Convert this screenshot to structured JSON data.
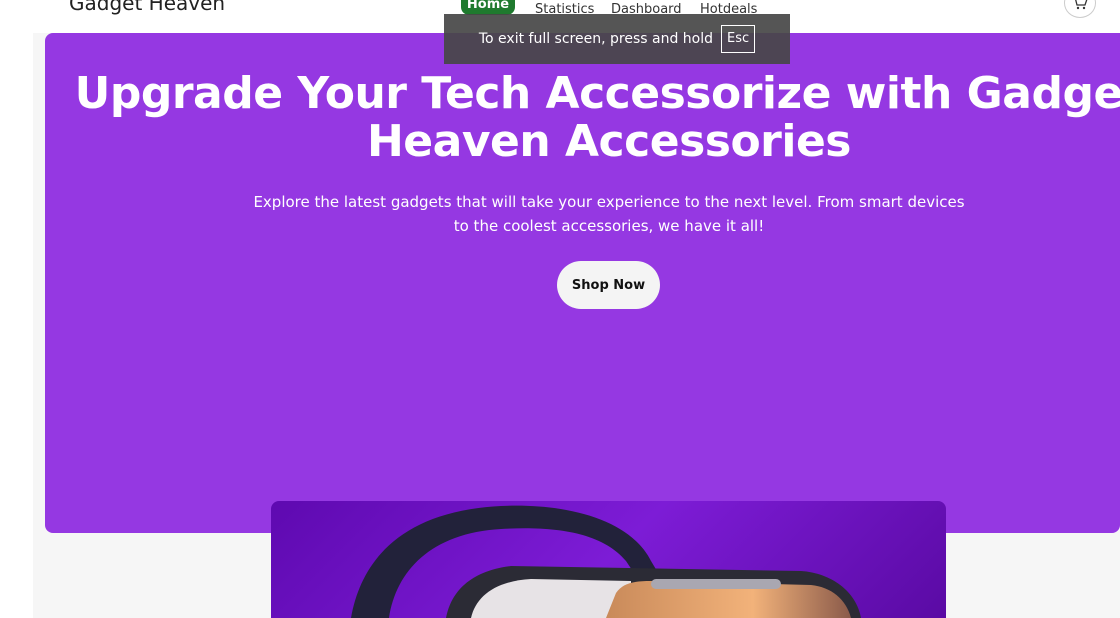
{
  "header": {
    "brand": "Gadget Heaven",
    "nav": {
      "home": "Home",
      "statistics": "Statistics",
      "dashboard": "Dashboard",
      "hotdeals": "Hotdeals"
    },
    "cart_icon": "cart-icon"
  },
  "hero": {
    "title": "Upgrade Your Tech Accessorize with Gadget Heaven Accessories",
    "subtitle": "Explore the latest gadgets that will take your experience to the next level. From smart devices to the coolest accessories, we have it all!",
    "cta": "Shop Now"
  },
  "fullscreen_notice": {
    "text": "To exit full screen, press and hold",
    "key": "Esc"
  },
  "colors": {
    "hero_bg": "#9538e2",
    "home_active": "#1f7a2e",
    "page_bg": "#f6f6f6"
  }
}
